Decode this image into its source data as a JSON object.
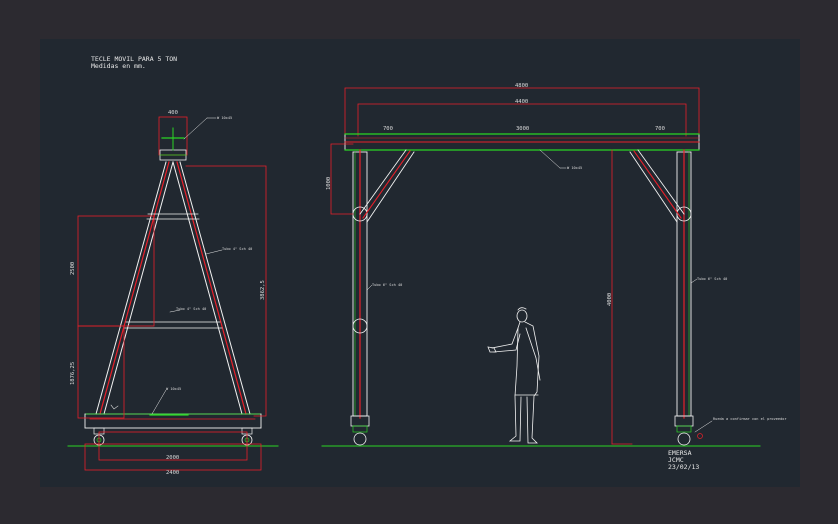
{
  "title": {
    "line1": "TECLE MOVIL PARA 5 TON",
    "line2": "Medidas en mm."
  },
  "side_view": {
    "dim_top": "400",
    "dim_bottom_inner": "2000",
    "dim_bottom_outer": "2400",
    "dim_left_upper": "2500",
    "dim_left_lower": "1876,25",
    "dim_right": "3862,5",
    "label_tube": "Tubo 4\" Sch 40",
    "label_brace": "Tubo 4\" Sch 40",
    "label_beam": "W 10x45",
    "label_base": "W 10x45"
  },
  "front_view": {
    "dim_total": "4800",
    "dim_inner": "4400",
    "dim_left": "700",
    "dim_center": "3000",
    "dim_right": "700",
    "dim_brace": "1000",
    "dim_height": "4000",
    "label_beam": "W 10x45",
    "label_left_post": "Tubo 6\" Sch 40",
    "label_right_post": "Tubo 6\" Sch 40",
    "note": "Rueda a confirmar con el proveedor"
  },
  "signature": {
    "company": "EMERSA",
    "author": "JCMC",
    "date": "23/02/13"
  },
  "colors": {
    "background": "#212830",
    "outer_background": "#2c2a30",
    "dimension": "#e8202a",
    "object": "#f2f2f2",
    "ground": "#2ad424",
    "text": "#e8e8e8"
  }
}
